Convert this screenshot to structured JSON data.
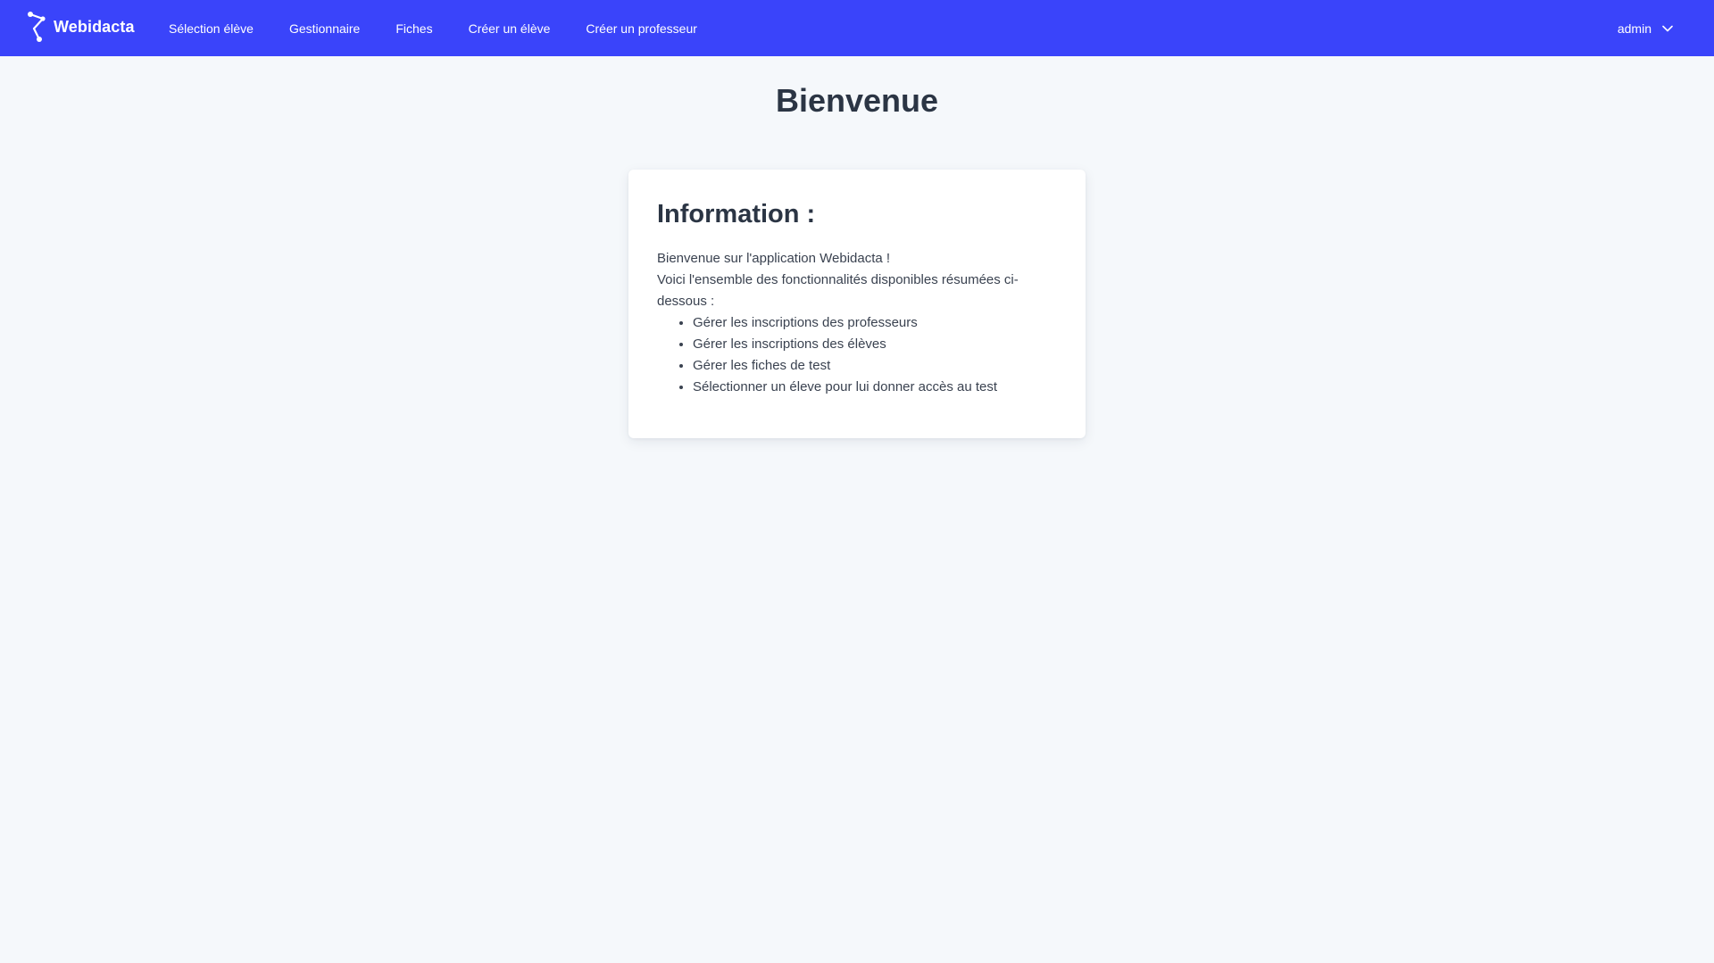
{
  "navbar": {
    "brand": {
      "name": "Webidacta",
      "icon": "webidacta-logo-icon"
    },
    "links": [
      {
        "label": "Sélection élève"
      },
      {
        "label": "Gestionnaire"
      },
      {
        "label": "Fiches"
      },
      {
        "label": "Créer un élève"
      },
      {
        "label": "Créer un professeur"
      }
    ],
    "user": {
      "name": "admin",
      "icon": "chevron-down-icon"
    },
    "background_color": "#3a44fa"
  },
  "main": {
    "title": "Bienvenue",
    "card": {
      "title": "Information :",
      "intro_line1": "Bienvenue sur l'application Webidacta !",
      "intro_line2": "Voici l'ensemble des fonctionnalités disponibles résumées ci-dessous :",
      "features": [
        "Gérer les inscriptions des professeurs",
        "Gérer les inscriptions des élèves",
        "Gérer les fiches de test",
        "Sélectionner un éleve pour lui donner accès au test"
      ]
    }
  },
  "colors": {
    "page_background": "#f5f8fb",
    "text_primary": "#2b3544"
  }
}
